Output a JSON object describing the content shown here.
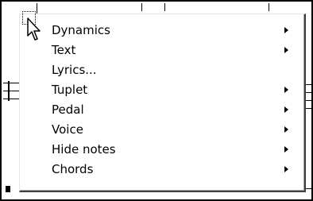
{
  "menu": {
    "items": [
      {
        "label": "Dynamics",
        "submenu": true
      },
      {
        "label": "Text",
        "submenu": true
      },
      {
        "label": "Lyrics...",
        "submenu": false
      },
      {
        "label": "Tuplet",
        "submenu": true
      },
      {
        "label": "Pedal",
        "submenu": true
      },
      {
        "label": "Voice",
        "submenu": true
      },
      {
        "label": "Hide notes",
        "submenu": true
      },
      {
        "label": "Chords",
        "submenu": true
      }
    ]
  },
  "icons": {
    "cursor": "arrow-cursor-icon",
    "submenu": "triangle-right-icon"
  },
  "colors": {
    "menu_background": "#ffffff",
    "text": "#000000",
    "shadow": "#404040"
  }
}
